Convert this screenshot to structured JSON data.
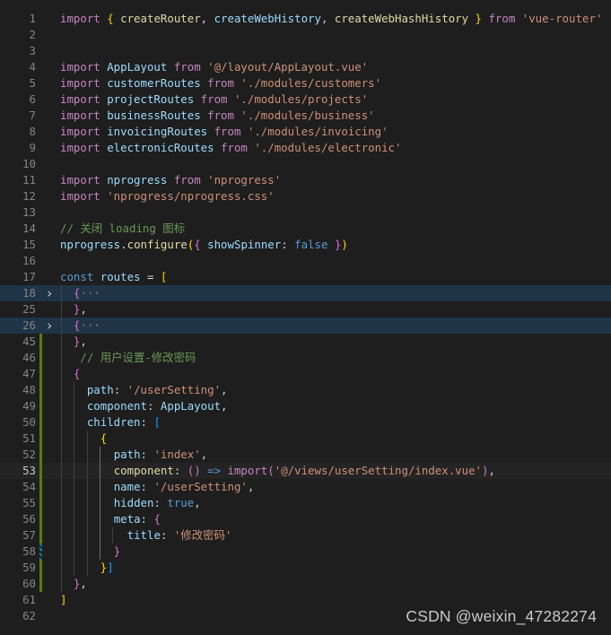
{
  "colors": {
    "background": "#1e1e1e",
    "keyword": "#c586c0",
    "declaration": "#569cd6",
    "variable": "#9cdcfe",
    "function": "#dcdcaa",
    "string": "#ce9178",
    "comment": "#6a9955",
    "bracket_gold": "#ffd700",
    "bracket_orchid": "#da70d6",
    "bracket_blue": "#179fff",
    "git_modified": "#587c0c",
    "fold_highlight": "#1f3447"
  },
  "editor": {
    "language": "javascript",
    "active_line": "53",
    "lines": [
      {
        "n": "1",
        "t": [
          [
            "kw",
            "import "
          ],
          [
            "b1",
            "{ "
          ],
          [
            "fn",
            "createRouter"
          ],
          [
            "pl",
            ", "
          ],
          [
            "var",
            "createWebHistory"
          ],
          [
            "pl",
            ", "
          ],
          [
            "fn",
            "createWebHashHistory"
          ],
          [
            "b1",
            " }"
          ],
          [
            "kw",
            " from "
          ],
          [
            "str",
            "'vue-router'"
          ]
        ]
      },
      {
        "n": "2",
        "t": []
      },
      {
        "n": "3",
        "t": []
      },
      {
        "n": "4",
        "t": [
          [
            "kw",
            "import "
          ],
          [
            "var",
            "AppLayout"
          ],
          [
            "kw",
            " from "
          ],
          [
            "str",
            "'@/layout/AppLayout.vue'"
          ]
        ]
      },
      {
        "n": "5",
        "t": [
          [
            "kw",
            "import "
          ],
          [
            "var",
            "customerRoutes"
          ],
          [
            "kw",
            " from "
          ],
          [
            "str",
            "'./modules/customers'"
          ]
        ]
      },
      {
        "n": "6",
        "t": [
          [
            "kw",
            "import "
          ],
          [
            "var",
            "projectRoutes"
          ],
          [
            "kw",
            " from "
          ],
          [
            "str",
            "'./modules/projects'"
          ]
        ]
      },
      {
        "n": "7",
        "t": [
          [
            "kw",
            "import "
          ],
          [
            "var",
            "businessRoutes"
          ],
          [
            "kw",
            " from "
          ],
          [
            "str",
            "'./modules/business'"
          ]
        ]
      },
      {
        "n": "8",
        "t": [
          [
            "kw",
            "import "
          ],
          [
            "var",
            "invoicingRoutes"
          ],
          [
            "kw",
            " from "
          ],
          [
            "str",
            "'./modules/invoicing'"
          ]
        ]
      },
      {
        "n": "9",
        "t": [
          [
            "kw",
            "import "
          ],
          [
            "var",
            "electronicRoutes"
          ],
          [
            "kw",
            " from "
          ],
          [
            "str",
            "'./modules/electronic'"
          ]
        ]
      },
      {
        "n": "10",
        "t": []
      },
      {
        "n": "11",
        "t": [
          [
            "kw",
            "import "
          ],
          [
            "var",
            "nprogress"
          ],
          [
            "kw",
            " from "
          ],
          [
            "str",
            "'nprogress'"
          ]
        ]
      },
      {
        "n": "12",
        "t": [
          [
            "kw",
            "import "
          ],
          [
            "str",
            "'nprogress/nprogress.css'"
          ]
        ]
      },
      {
        "n": "13",
        "t": []
      },
      {
        "n": "14",
        "t": [
          [
            "cm",
            "// 关闭 loading 图标"
          ]
        ]
      },
      {
        "n": "15",
        "t": [
          [
            "var",
            "nprogress"
          ],
          [
            "pl",
            "."
          ],
          [
            "fn",
            "configure"
          ],
          [
            "b1",
            "("
          ],
          [
            "b2",
            "{ "
          ],
          [
            "var",
            "showSpinner"
          ],
          [
            "pl",
            ": "
          ],
          [
            "dk",
            "false"
          ],
          [
            "b2",
            " }"
          ],
          [
            "b1",
            ")"
          ]
        ]
      },
      {
        "n": "16",
        "t": []
      },
      {
        "n": "17",
        "t": [
          [
            "dk",
            "const "
          ],
          [
            "var",
            "routes"
          ],
          [
            "pl",
            " = "
          ],
          [
            "b1",
            "["
          ]
        ]
      },
      {
        "n": "18",
        "fold": true,
        "hl": true,
        "t": [
          [
            "pl",
            "  "
          ],
          [
            "b2",
            "{"
          ],
          [
            "ell",
            "···"
          ]
        ]
      },
      {
        "n": "25",
        "t": [
          [
            "pl",
            "  "
          ],
          [
            "b2",
            "}"
          ],
          [
            "pl",
            ","
          ]
        ]
      },
      {
        "n": "26",
        "fold": true,
        "hl": true,
        "t": [
          [
            "pl",
            "  "
          ],
          [
            "b2",
            "{"
          ],
          [
            "ell",
            "···"
          ]
        ]
      },
      {
        "n": "45",
        "mod": true,
        "t": [
          [
            "pl",
            "  "
          ],
          [
            "b2",
            "}"
          ],
          [
            "pl",
            ","
          ]
        ]
      },
      {
        "n": "46",
        "mod": true,
        "t": [
          [
            "pl",
            "   "
          ],
          [
            "cm",
            "// 用户设置-修改密码"
          ]
        ]
      },
      {
        "n": "47",
        "mod": true,
        "t": [
          [
            "pl",
            "  "
          ],
          [
            "b2",
            "{"
          ]
        ]
      },
      {
        "n": "48",
        "mod": true,
        "t": [
          [
            "pl",
            "    "
          ],
          [
            "var",
            "path"
          ],
          [
            "pl",
            ": "
          ],
          [
            "str",
            "'/userSetting'"
          ],
          [
            "pl",
            ","
          ]
        ]
      },
      {
        "n": "49",
        "mod": true,
        "t": [
          [
            "pl",
            "    "
          ],
          [
            "var",
            "component"
          ],
          [
            "pl",
            ": "
          ],
          [
            "var",
            "AppLayout"
          ],
          [
            "pl",
            ","
          ]
        ]
      },
      {
        "n": "50",
        "mod": true,
        "t": [
          [
            "pl",
            "    "
          ],
          [
            "var",
            "children"
          ],
          [
            "pl",
            ": "
          ],
          [
            "b3",
            "["
          ]
        ]
      },
      {
        "n": "51",
        "mod": true,
        "t": [
          [
            "pl",
            "      "
          ],
          [
            "b1",
            "{"
          ]
        ]
      },
      {
        "n": "52",
        "mod": true,
        "t": [
          [
            "pl",
            "        "
          ],
          [
            "var",
            "path"
          ],
          [
            "pl",
            ": "
          ],
          [
            "str",
            "'index'"
          ],
          [
            "pl",
            ","
          ]
        ]
      },
      {
        "n": "53",
        "mod": true,
        "t": [
          [
            "pl",
            "        "
          ],
          [
            "fn",
            "component"
          ],
          [
            "pl",
            ": "
          ],
          [
            "b2",
            "()"
          ],
          [
            "dk",
            " => "
          ],
          [
            "kw",
            "import"
          ],
          [
            "b2",
            "("
          ],
          [
            "str",
            "'@/views/userSetting/index.vue'"
          ],
          [
            "b2",
            ")"
          ],
          [
            "pl",
            ","
          ]
        ]
      },
      {
        "n": "54",
        "mod": true,
        "t": [
          [
            "pl",
            "        "
          ],
          [
            "var",
            "name"
          ],
          [
            "pl",
            ": "
          ],
          [
            "str",
            "'/userSetting'"
          ],
          [
            "pl",
            ","
          ]
        ]
      },
      {
        "n": "55",
        "mod": true,
        "t": [
          [
            "pl",
            "        "
          ],
          [
            "var",
            "hidden"
          ],
          [
            "pl",
            ": "
          ],
          [
            "dk",
            "true"
          ],
          [
            "pl",
            ","
          ]
        ]
      },
      {
        "n": "56",
        "mod": true,
        "t": [
          [
            "pl",
            "        "
          ],
          [
            "var",
            "meta"
          ],
          [
            "pl",
            ": "
          ],
          [
            "b2",
            "{"
          ]
        ]
      },
      {
        "n": "57",
        "mod": true,
        "t": [
          [
            "pl",
            "          "
          ],
          [
            "var",
            "title"
          ],
          [
            "pl",
            ": "
          ],
          [
            "str",
            "'修改密码'"
          ]
        ]
      },
      {
        "n": "58",
        "mod": true,
        "striped": true,
        "t": [
          [
            "pl",
            "        "
          ],
          [
            "b2",
            "}"
          ]
        ]
      },
      {
        "n": "59",
        "mod": true,
        "t": [
          [
            "pl",
            "      "
          ],
          [
            "b1",
            "}"
          ],
          [
            "b3",
            "]"
          ]
        ]
      },
      {
        "n": "60",
        "mod": true,
        "t": [
          [
            "pl",
            "  "
          ],
          [
            "b2",
            "}"
          ],
          [
            "pl",
            ","
          ]
        ]
      },
      {
        "n": "61",
        "t": [
          [
            "b1",
            "]"
          ]
        ]
      },
      {
        "n": "62",
        "t": []
      }
    ]
  },
  "watermark": "CSDN @weixin_47282274"
}
